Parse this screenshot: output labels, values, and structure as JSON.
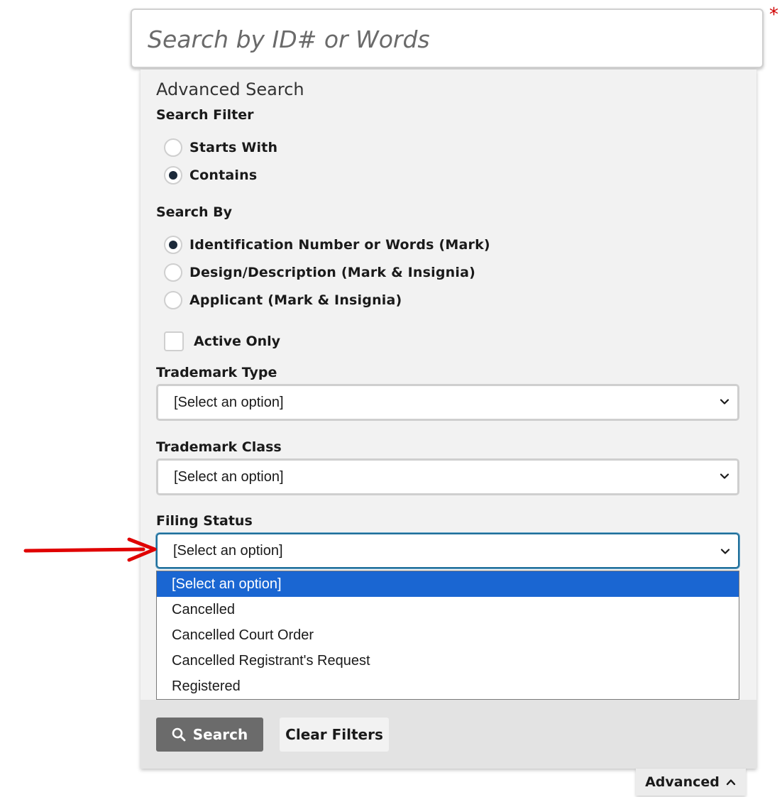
{
  "search": {
    "placeholder": "Search by ID# or Words",
    "required_marker": "*"
  },
  "advanced": {
    "title": "Advanced Search",
    "search_filter": {
      "label": "Search Filter",
      "options": [
        "Starts With",
        "Contains"
      ],
      "selected": "Contains"
    },
    "search_by": {
      "label": "Search By",
      "options": [
        "Identification Number or Words (Mark)",
        "Design/Description (Mark & Insignia)",
        "Applicant (Mark & Insignia)"
      ],
      "selected": "Identification Number or Words (Mark)"
    },
    "active_only": {
      "label": "Active Only",
      "checked": false
    },
    "trademark_type": {
      "label": "Trademark Type",
      "value": "[Select an option]"
    },
    "trademark_class": {
      "label": "Trademark Class",
      "value": "[Select an option]"
    },
    "filing_status": {
      "label": "Filing Status",
      "value": "[Select an option]",
      "options": [
        "[Select an option]",
        "Cancelled",
        "Cancelled Court Order",
        "Cancelled Registrant's Request",
        "Registered"
      ],
      "highlighted": "[Select an option]"
    },
    "buttons": {
      "search": "Search",
      "clear": "Clear Filters"
    },
    "toggle_label": "Advanced"
  },
  "colors": {
    "annotation_arrow": "#e00000",
    "required": "#d00000",
    "highlight": "#1a66d2",
    "search_button": "#6b6b6b"
  },
  "icons": [
    "search-icon",
    "chevron-down-icon",
    "chevron-up-icon",
    "red-arrow-annotation"
  ]
}
